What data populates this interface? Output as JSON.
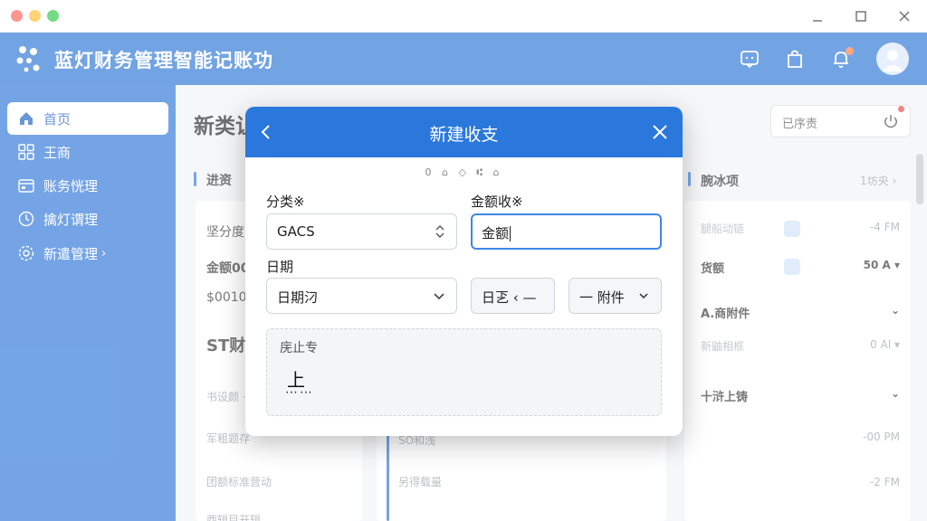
{
  "window": {
    "minimize": "minimize",
    "maximize": "maximize",
    "close": "close"
  },
  "app": {
    "title": "蓝灯财务管理智能记账功",
    "brand_color": "#2773d6",
    "header_icons": [
      "chat-icon",
      "bag-icon",
      "bell-icon",
      "avatar"
    ]
  },
  "sidebar": {
    "items": [
      {
        "label": "首页",
        "icon": "home-icon",
        "active": true
      },
      {
        "label": "王商",
        "icon": "grid-icon"
      },
      {
        "label": "账务恍理",
        "icon": "wallet-icon"
      },
      {
        "label": "擒灯谓理",
        "icon": "target-icon"
      },
      {
        "label": "新遣管理",
        "icon": "settings-icon",
        "arrow": "›"
      }
    ]
  },
  "background": {
    "page_title": "新类让",
    "search_placeholder": "已序责",
    "left": {
      "heading": "进资",
      "rows": [
        "坚分度",
        "金额00",
        "$0010",
        "ST财",
        "书设颜ㆍ",
        "军粗题存",
        "团额标准营动",
        "西辑目开辑"
      ]
    },
    "mid": {
      "rows": [
        "SO和浅",
        "另得载量"
      ]
    },
    "right": {
      "heading": "腕冰项",
      "more": "1坊央 ›",
      "rows": [
        {
          "label": "腿船动链",
          "value": "-4 FM",
          "check": true
        },
        {
          "label": "货额",
          "value": "50 A ▾",
          "check": true
        },
        {
          "label": "A.商附件",
          "value": "⌄"
        },
        {
          "label": "新鼬相框",
          "value": "0 Al ▾"
        },
        {
          "label": "十浒上铸",
          "value": "⌄"
        },
        {
          "label": "",
          "value": "-00 PM"
        },
        {
          "label": "",
          "value": "-2 FM"
        }
      ]
    }
  },
  "modal": {
    "title": "新建收支",
    "step_glyphs": "0 ⌂ ◇ ⑆ ⌂",
    "category": {
      "label": "分类※",
      "value": "GACS"
    },
    "amount": {
      "label": "金额收※",
      "value": "金额"
    },
    "date": {
      "label": "日期",
      "value": "日期汈"
    },
    "time": {
      "value": "日乤 ‹ —"
    },
    "attachment": {
      "value": "一 附件"
    },
    "notes": {
      "label": "庑止专",
      "upload_glyph": "上",
      "dots": "⋯⋯"
    }
  }
}
